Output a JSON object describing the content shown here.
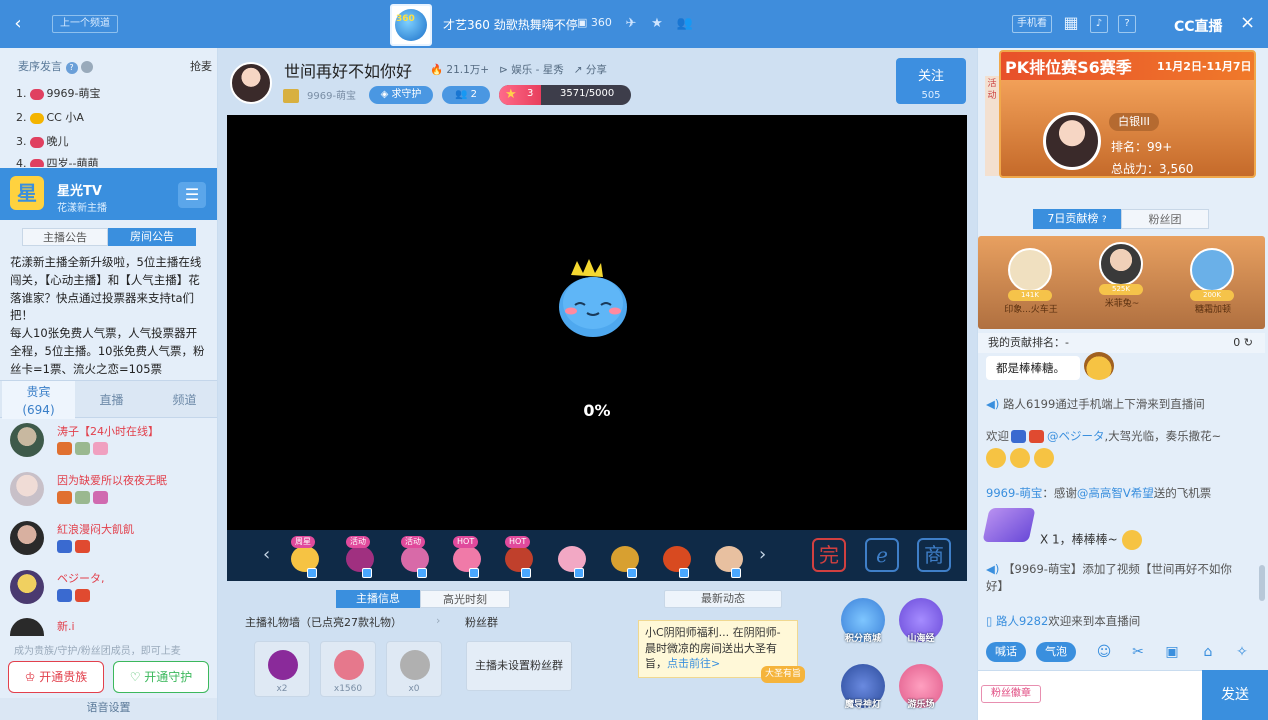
{
  "topbar": {
    "back": "‹",
    "prev_channel": "上一个频道",
    "logo": "360",
    "title": "才艺360 劲歌热舞嗨不停",
    "room_id": "360",
    "phone_watch": "手机看",
    "help": "?",
    "brand": "CC直播",
    "close": "×"
  },
  "left": {
    "header_left": "麦序发言",
    "header_right": "抢麦",
    "ranks": [
      {
        "no": "1.",
        "name": "9969-萌宝"
      },
      {
        "no": "2.",
        "name": "CC 小A"
      },
      {
        "no": "3.",
        "name": "晚儿"
      },
      {
        "no": "4.",
        "name": "四岁--萌萌"
      }
    ],
    "anchor": {
      "logo": "星",
      "name": "星光TV",
      "subtitle": "花漾新主播",
      "menu": "☰"
    },
    "notice_tabs": [
      "主播公告",
      "房间公告"
    ],
    "notice_text": "花漾新主播全新升级啦，5位主播在线闯关，【心动主播】和【人气主播】花落谁家？快点通过投票器来支持ta们把！\n每人10张免费人气票，人气投票器开全程，5位主播。10张免费人气票，粉丝卡=1票、流火之恋=105票",
    "tabs": [
      {
        "label": "贵宾",
        "count": "(694)"
      },
      {
        "label": "直播",
        "count": ""
      },
      {
        "label": "频道",
        "count": ""
      }
    ],
    "vips": [
      {
        "name": "涛子【24小时在线】"
      },
      {
        "name": "因为缺爱所以夜夜无眠"
      },
      {
        "name": "紅浪漫闷大飢飢"
      },
      {
        "name": "ベジータ,"
      },
      {
        "name": "新.i"
      }
    ],
    "bottom_tip": "成为贵族/守护/粉丝团成员，即可上麦",
    "btn_noble": "开通贵族",
    "btn_guard": "开通守护",
    "voice_settings": "语音设置"
  },
  "room": {
    "title": "世间再好不如你好",
    "heat": "21.1万+",
    "category": "娱乐 - 星秀",
    "share": "分享",
    "owner": "9969-萌宝",
    "seek_guard": "求守护",
    "fans": "2",
    "level": "3",
    "level_progress_text": "3571/5000",
    "level_progress": 0.7142,
    "follow_label": "关注",
    "follow_count": "505"
  },
  "player": {
    "loading": "0%"
  },
  "giftbar": {
    "gifts": [
      {
        "tag": "周星",
        "color": "#f6c343"
      },
      {
        "tag": "活动",
        "color": "#a03080"
      },
      {
        "tag": "活动",
        "color": "#d86aa8"
      },
      {
        "tag": "HOT",
        "color": "#f07aa8"
      },
      {
        "tag": "HOT",
        "color": "#c0402c"
      },
      {
        "tag": "",
        "color": "#f2a8c4"
      },
      {
        "tag": "",
        "color": "#d8a030"
      },
      {
        "tag": "",
        "color": "#d84a20"
      },
      {
        "tag": "",
        "color": "#e8c0a0"
      }
    ],
    "big_buttons": [
      "完",
      "ℯ",
      "商"
    ]
  },
  "info": {
    "tabs": [
      "主播信息",
      "高光时刻"
    ],
    "gift_wall": "主播礼物墙（已点亮27款礼物）",
    "fan_group": "粉丝群",
    "wall_items": [
      {
        "count": "x2",
        "color": "#8a2a9a"
      },
      {
        "count": "x1560",
        "color": "#e6788c"
      },
      {
        "count": "x0",
        "color": "#b0b0b0"
      }
    ],
    "no_fan_group": "主播未设置粉丝群",
    "news_header": "最新动态",
    "news_text": "小C阴阳师福利... 在阴阳师-晨时微凉的房间送出大圣有旨，",
    "news_link": "点击前往>",
    "news_badge": "大圣有旨",
    "apps": [
      {
        "label": "积分商城",
        "color": "#3a7fd8"
      },
      {
        "label": "山海经",
        "color": "#6a4ad8"
      },
      {
        "label": "魔导神灯",
        "color": "#2a4a9a"
      },
      {
        "label": "游乐场",
        "color": "#e05a8a"
      }
    ]
  },
  "right": {
    "side_activity": "活动",
    "pk_title": "PK排位赛S6赛季",
    "pk_dates": "11月2日-11月7日",
    "pk_level": "白银III",
    "pk_rank": "排名：99+",
    "pk_power": "总战力：3,560",
    "tabs": [
      "7日贡献榜",
      "粉丝团"
    ],
    "top3": [
      {
        "score": "141K",
        "name": "印象...火车王",
        "color": "#f0e0c0"
      },
      {
        "score": "525K",
        "name": "米菲兔~",
        "color": "#d8b8a0"
      },
      {
        "score": "200K",
        "name": "糖霜加顿",
        "color": "#6ab0e8"
      }
    ],
    "my_rank_label": "我的贡献排名：-",
    "my_rank_value": "0",
    "bubble": "都是棒棒糖。",
    "messages": [
      {
        "pre": "路人6199",
        "text": "通过手机端上下滑来到直播间"
      },
      {
        "pre": "欢迎",
        "user": "@ベジータ",
        "text": ",大驾光临，奏乐撒花~"
      },
      {
        "pre": "9969-萌宝",
        "text": "：感谢",
        "user": "@高高智V希望",
        "text2": "送的飞机票"
      },
      {
        "text": "X 1，棒棒棒~"
      },
      {
        "text": "【9969-萌宝】添加了视频【世间再好不如你好】"
      },
      {
        "pre": "路人9282",
        "text": "欢迎来到本直播间"
      }
    ],
    "tools": [
      "喊话",
      "气泡"
    ],
    "fan_badge": "粉丝徽章",
    "send": "发送"
  }
}
